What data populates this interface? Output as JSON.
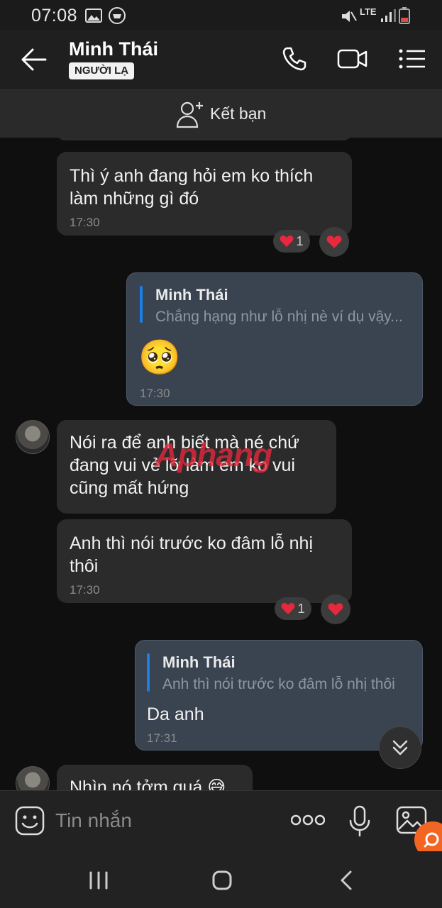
{
  "status_bar": {
    "time": "07:08",
    "network": "LTE"
  },
  "header": {
    "contact_name": "Minh Thái",
    "badge": "NGƯỜI LẠ"
  },
  "add_friend": {
    "label": "Kết bạn"
  },
  "messages": [
    {
      "text": "Thì ý anh đang hỏi em ko thích làm những gì đó",
      "time": "17:30",
      "reaction_count": "1"
    },
    {
      "quote_name": "Minh Thái",
      "quote_text": "Chẳng hạng như lỗ nhị nè ví dụ vậy...",
      "emoji": "🥺",
      "time": "17:30"
    },
    {
      "text": "Nói ra để anh biết mà né chứ đang vui vẻ lỡ làm em ko vui cũng mất hứng"
    },
    {
      "text": "Anh thì nói trước ko đâm lỗ nhị thôi",
      "time": "17:30",
      "reaction_count": "1"
    },
    {
      "quote_name": "Minh Thái",
      "quote_text": "Anh thì nói trước ko đâm lỗ nhị thôi",
      "text": "Da anh",
      "time": "17:31"
    },
    {
      "text": "Nhìn nó tởm quá 😅"
    }
  ],
  "watermark": "Aphang",
  "composer": {
    "placeholder": "Tin nhắn"
  },
  "colors": {
    "accent": "#1a7fe8",
    "outgoing_bubble": "#3a4350",
    "incoming_bubble": "#2b2b2b",
    "heart": "#e8283c",
    "badge_orange": "#f26522"
  }
}
